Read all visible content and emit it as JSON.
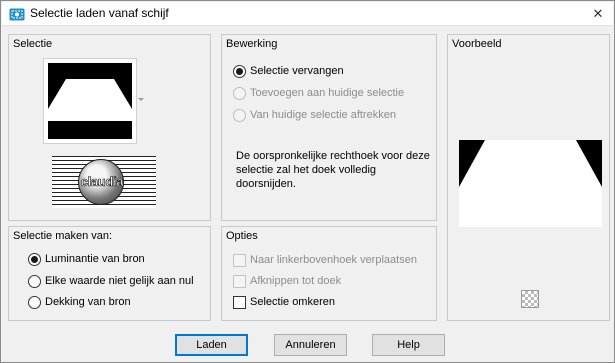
{
  "window": {
    "title": "Selectie laden vanaf schijf",
    "icon": "selection-load-icon",
    "close_glyph": "✕"
  },
  "groups": {
    "selectie": {
      "title": "Selectie",
      "thumbnail_icon": "selection-thumbnail",
      "logo_text": "claudia"
    },
    "bewerking": {
      "title": "Bewerking",
      "options": [
        {
          "label": "Selectie vervangen",
          "checked": true,
          "disabled": false
        },
        {
          "label": "Toevoegen aan huidige selectie",
          "checked": false,
          "disabled": true
        },
        {
          "label": "Van huidige selectie aftrekken",
          "checked": false,
          "disabled": true
        }
      ],
      "description": "De oorspronkelijke rechthoek voor deze selectie zal het doek volledig doorsnijden."
    },
    "voorbeeld": {
      "title": "Voorbeeld",
      "transparency_icon": "checker-icon"
    },
    "maken_van": {
      "title": "Selectie maken van:",
      "options": [
        {
          "label": "Luminantie van bron",
          "checked": true
        },
        {
          "label": "Elke waarde niet gelijk aan nul",
          "checked": false
        },
        {
          "label": "Dekking van bron",
          "checked": false
        }
      ]
    },
    "opties": {
      "title": "Opties",
      "options": [
        {
          "label": "Naar linkerbovenhoek verplaatsen",
          "checked": false,
          "disabled": true
        },
        {
          "label": "Afknippen tot doek",
          "checked": false,
          "disabled": true
        },
        {
          "label": "Selectie omkeren",
          "checked": false,
          "disabled": false
        }
      ]
    }
  },
  "buttons": {
    "load": "Laden",
    "cancel": "Annuleren",
    "help": "Help"
  },
  "colors": {
    "accent": "#0078d7",
    "window_bg": "#f0f0f0",
    "icon_blue": "#1e90c8"
  }
}
